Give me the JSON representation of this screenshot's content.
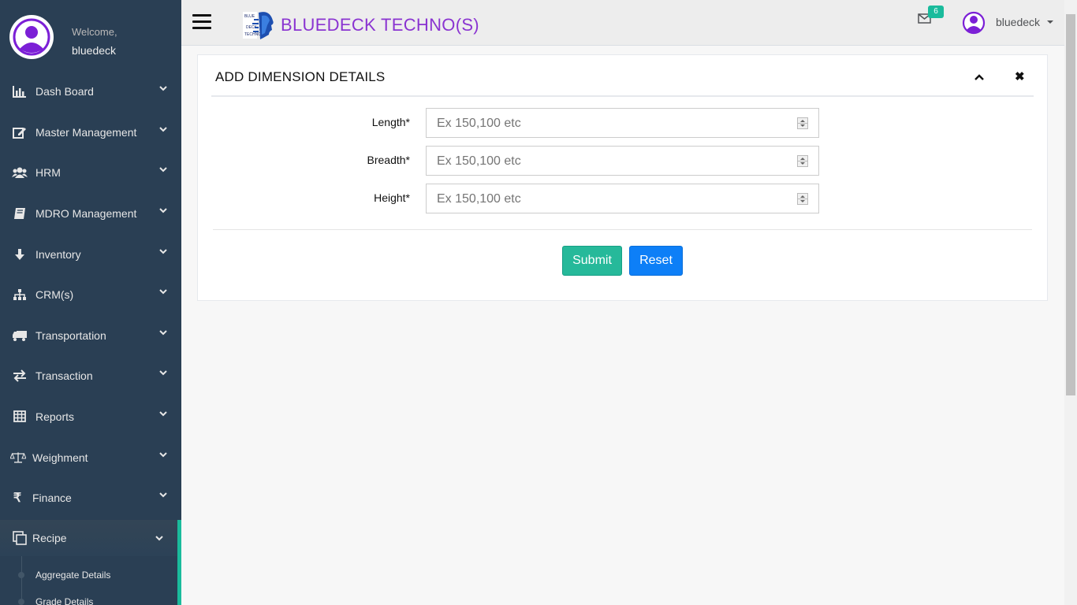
{
  "profile": {
    "welcome": "Welcome,",
    "name": "bluedeck"
  },
  "sidebar": {
    "items": [
      {
        "label": "Dash Board",
        "icon": "bar-chart-icon"
      },
      {
        "label": "Master Management",
        "icon": "edit-icon"
      },
      {
        "label": "HRM",
        "icon": "users-icon"
      },
      {
        "label": "MDRO Management",
        "icon": "book-icon"
      },
      {
        "label": "Inventory",
        "icon": "arrow-down-icon"
      },
      {
        "label": "CRM(s)",
        "icon": "sitemap-icon"
      },
      {
        "label": "Transportation",
        "icon": "truck-icon"
      },
      {
        "label": "Transaction",
        "icon": "exchange-icon"
      },
      {
        "label": "Reports",
        "icon": "table-icon"
      },
      {
        "label": "Weighment",
        "icon": "balance-scale-icon"
      },
      {
        "label": "Finance",
        "icon": "rupee-icon"
      },
      {
        "label": "Recipe",
        "icon": "clone-icon"
      }
    ],
    "submenu": [
      "Aggregate Details",
      "Grade Details"
    ]
  },
  "topnav": {
    "brand": "BLUEDECK TECHNO(S)",
    "mail_count": "6",
    "user": "bluedeck"
  },
  "panel": {
    "title": "ADD DIMENSION DETAILS",
    "fields": [
      {
        "label": "Length*",
        "placeholder": "Ex 150,100 etc"
      },
      {
        "label": "Breadth*",
        "placeholder": "Ex 150,100 etc"
      },
      {
        "label": "Height*",
        "placeholder": "Ex 150,100 etc"
      }
    ],
    "submit": "Submit",
    "reset": "Reset"
  },
  "colors": {
    "sidebar": "#2a3f54",
    "accent": "#1abb9c",
    "brand": "#8a34d1",
    "reset": "#0d7ff7"
  }
}
